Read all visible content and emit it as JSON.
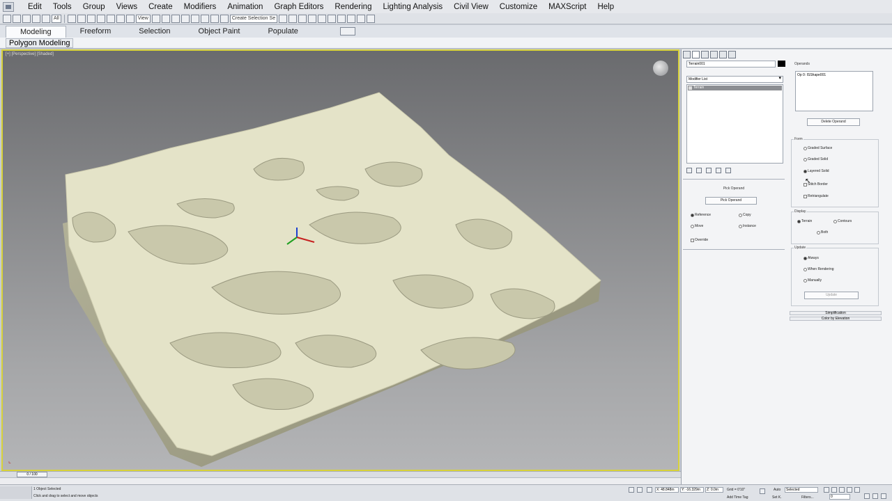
{
  "menu": [
    "Edit",
    "Tools",
    "Group",
    "Views",
    "Create",
    "Modifiers",
    "Animation",
    "Graph Editors",
    "Rendering",
    "Lighting Analysis",
    "Civil View",
    "Customize",
    "MAXScript",
    "Help"
  ],
  "toolbar": {
    "selection_filter": "All",
    "view_dropdown": "View",
    "named_selection": "Create Selection Se"
  },
  "ribbon": {
    "tabs": [
      "Modeling",
      "Freeform",
      "Selection",
      "Object Paint",
      "Populate"
    ],
    "active_tab": "Modeling",
    "panel_label": "Polygon Modeling"
  },
  "viewport": {
    "label": "[+] [Perspective] [Shaded]",
    "border_color": "#d8d23a",
    "terrain_color": "#e6e5cb"
  },
  "command_panel": {
    "object_name": "Terrain001",
    "modifier_list": "Modifier List",
    "stack_items": [
      "Terrain"
    ],
    "pick_operand": {
      "title": "Pick Operand",
      "button": "Pick Operand",
      "options": [
        "Reference",
        "Copy",
        "Move",
        "Instance"
      ],
      "selected": "Reference",
      "override": "Override"
    },
    "operands": {
      "title": "Operands",
      "items": [
        "Op 0: ISShape001"
      ],
      "delete_button": "Delete Operand"
    },
    "form": {
      "title": "Form",
      "options": [
        "Graded Surface",
        "Graded Solid",
        "Layered Solid",
        "Stitch Border",
        "Retriangulate"
      ],
      "selected": "Layered Solid"
    },
    "display": {
      "title": "Display",
      "options": [
        "Terrain",
        "Contours",
        "Both"
      ],
      "selected": "Terrain"
    },
    "update": {
      "title": "Update",
      "options": [
        "Always",
        "When Rendering",
        "Manually"
      ],
      "selected": "Always",
      "button": "Update"
    },
    "collapsed_rollouts": [
      "Simplification",
      "Color by Elevation"
    ]
  },
  "timeline": {
    "frame": "0 / 100"
  },
  "status": {
    "selection": "1 Object Selected",
    "hint": "Click and drag to select and move objects",
    "x": "X: 48.848m",
    "y": "Y: -16.329m",
    "z": "Z: 0.0m",
    "grid": "Grid = 0'10\"",
    "auto": "Auto",
    "set_k": "Set K.",
    "selected": "Selected",
    "filters": "Filters...",
    "add_time_tag": "Add Time Tag",
    "frame_field": "0"
  }
}
